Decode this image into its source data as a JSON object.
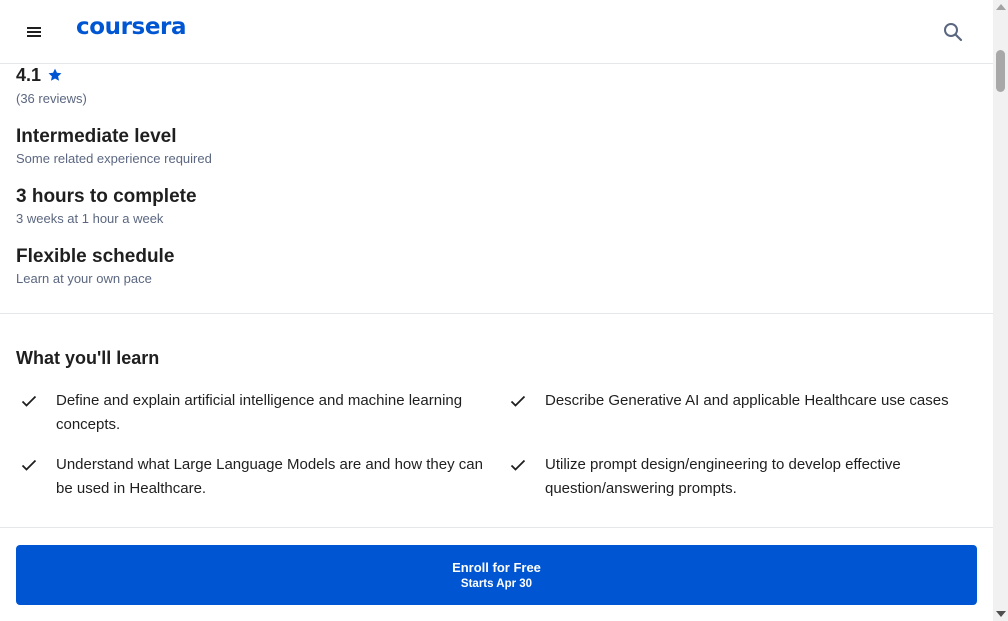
{
  "header": {
    "logo_text": "coursera",
    "brand_color": "#0056d2",
    "menu_icon": "hamburger-menu-icon",
    "search_icon": "search-icon"
  },
  "rating": {
    "value": "4.1",
    "star_icon": "star-icon",
    "reviews": "(36 reviews)"
  },
  "details": [
    {
      "title": "Intermediate level",
      "subtitle": "Some related experience required"
    },
    {
      "title": "3 hours to complete",
      "subtitle": "3 weeks at 1 hour a week"
    },
    {
      "title": "Flexible schedule",
      "subtitle": "Learn at your own pace"
    }
  ],
  "learn": {
    "title": "What you'll learn",
    "check_icon": "checkmark-icon",
    "items": [
      "Define and explain artificial intelligence and machine learning concepts.",
      "Describe Generative AI and applicable Healthcare use cases",
      "Understand what Large Language Models are and how they can be used in Healthcare.",
      "Utilize prompt design/engineering to develop effective question/answering prompts."
    ]
  },
  "enroll": {
    "label": "Enroll for Free",
    "sub_label": "Starts Apr 30"
  }
}
